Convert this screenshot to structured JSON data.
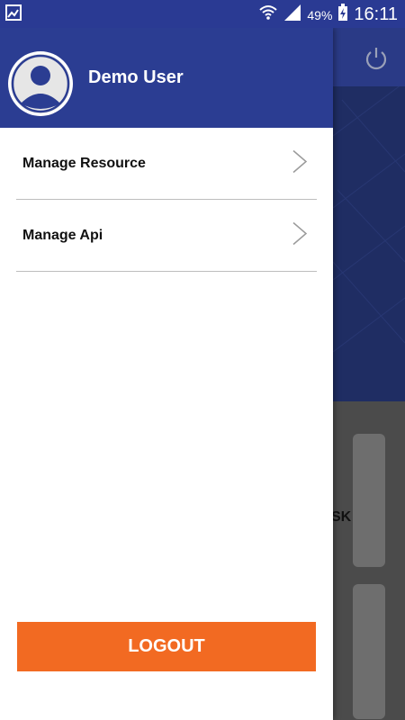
{
  "status_bar": {
    "battery_percent": "49%",
    "time": "16:11",
    "icons": [
      "gallery-notification-icon",
      "wifi-icon",
      "signal-icon",
      "battery-charging-icon"
    ]
  },
  "drawer": {
    "user_name": "Demo User",
    "items": [
      {
        "label": "Manage Resource",
        "icon": "chevron-right-icon"
      },
      {
        "label": "Manage Api",
        "icon": "chevron-right-icon"
      }
    ],
    "logout_label": "LOGOUT"
  },
  "background": {
    "card_text_fragment": "SK",
    "header_icon": "power-icon"
  },
  "colors": {
    "primary": "#2b3d92",
    "accent": "#f26a22",
    "status_bar": "#2a3a93"
  }
}
